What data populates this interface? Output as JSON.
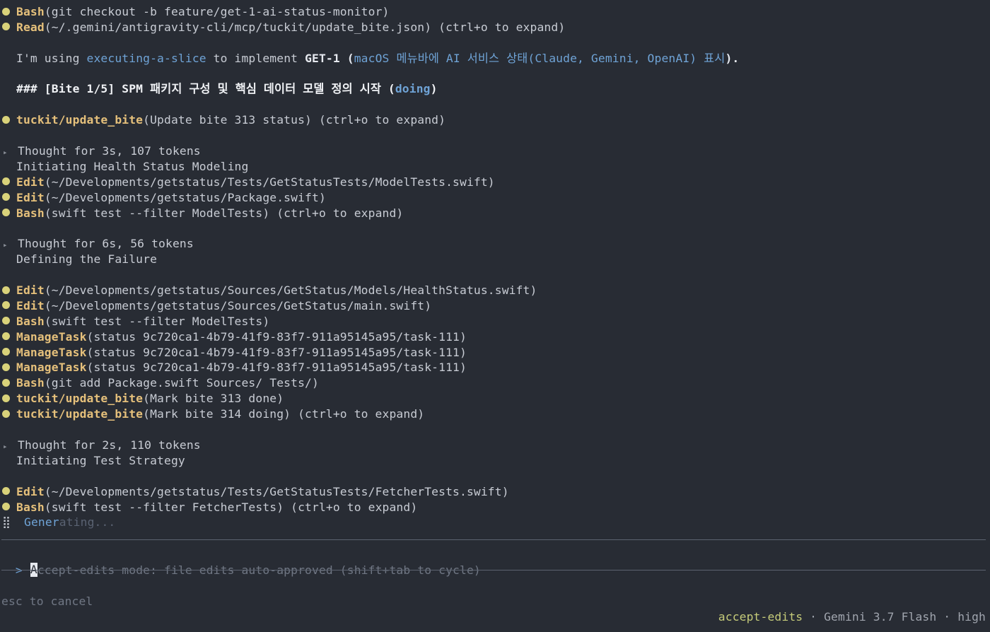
{
  "transcript": {
    "lines": [
      {
        "kind": "tool",
        "tool": "Bash",
        "args": "(git checkout -b feature/get-1-ai-status-monitor)"
      },
      {
        "kind": "tool",
        "tool": "Read",
        "args": "(~/.gemini/antigravity-cli/mcp/tuckit/update_bite.json) (ctrl+o to expand)"
      },
      {
        "kind": "blank"
      },
      {
        "kind": "skill",
        "pre": "I'm using ",
        "skill": "executing-a-slice",
        "mid": " to implement ",
        "ticket": "GET-1",
        "paren_open": " (",
        "title": "macOS 메뉴바에 AI 서비스 상태(Claude, Gemini, OpenAI) 표시",
        "paren_close": ")."
      },
      {
        "kind": "separator"
      },
      {
        "kind": "heading",
        "text": "### [Bite 1/5] SPM 패키지 구성 및 핵심 데이터 모델 정의 시작 (",
        "status": "doing",
        "close": ")"
      },
      {
        "kind": "blank"
      },
      {
        "kind": "tool",
        "tool": "tuckit/update_bite",
        "args": "(Update bite 313 status) (ctrl+o to expand)"
      },
      {
        "kind": "blank"
      },
      {
        "kind": "thought",
        "text": "Thought for 3s, 107 tokens"
      },
      {
        "kind": "plain",
        "text": "Initiating Health Status Modeling"
      },
      {
        "kind": "tool",
        "tool": "Edit",
        "args": "(~/Developments/getstatus/Tests/GetStatusTests/ModelTests.swift)"
      },
      {
        "kind": "tool",
        "tool": "Edit",
        "args": "(~/Developments/getstatus/Package.swift)"
      },
      {
        "kind": "tool",
        "tool": "Bash",
        "args": "(swift test --filter ModelTests) (ctrl+o to expand)"
      },
      {
        "kind": "blank"
      },
      {
        "kind": "thought",
        "text": "Thought for 6s, 56 tokens"
      },
      {
        "kind": "plain",
        "text": "Defining the Failure"
      },
      {
        "kind": "blank"
      },
      {
        "kind": "tool",
        "tool": "Edit",
        "args": "(~/Developments/getstatus/Sources/GetStatus/Models/HealthStatus.swift)"
      },
      {
        "kind": "tool",
        "tool": "Edit",
        "args": "(~/Developments/getstatus/Sources/GetStatus/main.swift)"
      },
      {
        "kind": "tool",
        "tool": "Bash",
        "args": "(swift test --filter ModelTests)"
      },
      {
        "kind": "tool",
        "tool": "ManageTask",
        "args": "(status 9c720ca1-4b79-41f9-83f7-911a95145a95/task-111)"
      },
      {
        "kind": "tool",
        "tool": "ManageTask",
        "args": "(status 9c720ca1-4b79-41f9-83f7-911a95145a95/task-111)"
      },
      {
        "kind": "tool",
        "tool": "ManageTask",
        "args": "(status 9c720ca1-4b79-41f9-83f7-911a95145a95/task-111)"
      },
      {
        "kind": "tool",
        "tool": "Bash",
        "args": "(git add Package.swift Sources/ Tests/)"
      },
      {
        "kind": "tool",
        "tool": "tuckit/update_bite",
        "args": "(Mark bite 313 done)"
      },
      {
        "kind": "tool",
        "tool": "tuckit/update_bite",
        "args": "(Mark bite 314 doing) (ctrl+o to expand)"
      },
      {
        "kind": "blank"
      },
      {
        "kind": "thought",
        "text": "Thought for 2s, 110 tokens"
      },
      {
        "kind": "plain",
        "text": "Initiating Test Strategy"
      },
      {
        "kind": "blank"
      },
      {
        "kind": "tool",
        "tool": "Edit",
        "args": "(~/Developments/getstatus/Tests/GetStatusTests/FetcherTests.swift)"
      },
      {
        "kind": "tool",
        "tool": "Bash",
        "args": "(swift test --filter FetcherTests) (ctrl+o to expand)"
      },
      {
        "kind": "generating",
        "icon": "⣿",
        "bright": "Gener",
        "dim": "ating..."
      }
    ]
  },
  "prompt": {
    "arrow": ">",
    "cursor_char": "A",
    "placeholder_rest": "ccept-edits mode: file edits auto-approved (shift+tab to cycle)"
  },
  "status_bar": {
    "left": "esc to cancel",
    "mode": "accept-edits",
    "separator": " · ",
    "model": "Gemini 3.7 Flash",
    "effort": "high"
  },
  "colors": {
    "background": "#282c34",
    "tool": "#e5c07b",
    "bullet": "#d9d27a",
    "link": "#6fa3d6",
    "mode": "#c6cc7a"
  },
  "icons": {
    "bullet": "dot-icon",
    "thought": "caret-right-icon",
    "spinner": "braille-spinner-icon",
    "prompt": "prompt-arrow-icon"
  }
}
